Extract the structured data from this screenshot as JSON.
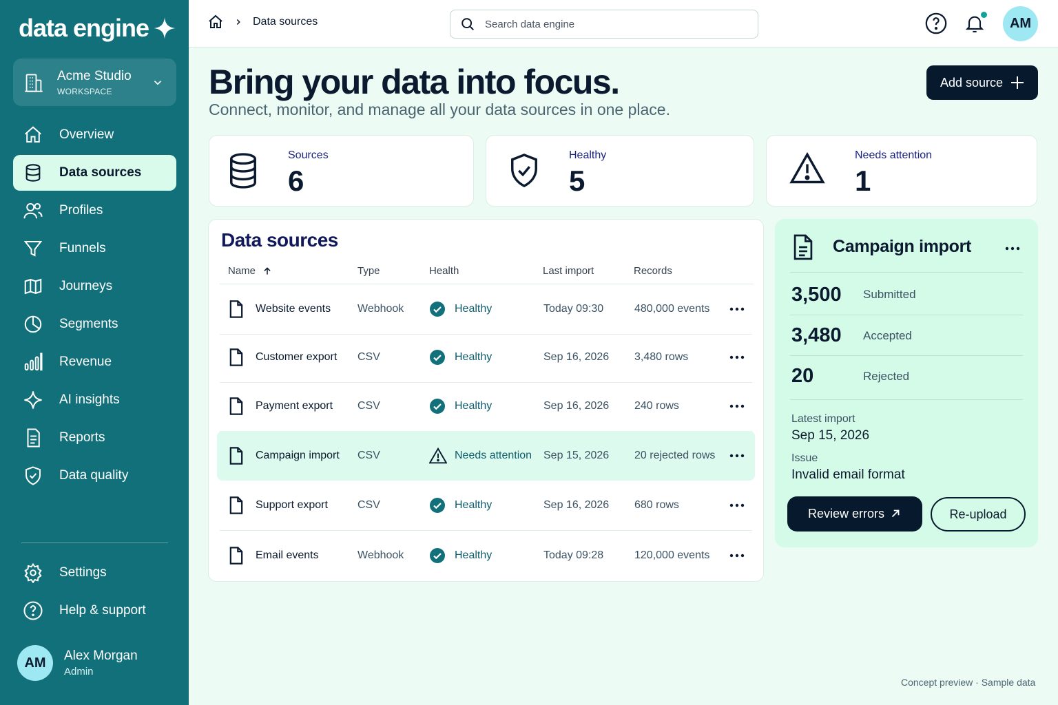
{
  "brand": {
    "name": "data engine"
  },
  "workspace": {
    "name": "Acme Studio",
    "label": "WORKSPACE"
  },
  "nav": {
    "items": [
      {
        "label": "Overview",
        "icon": "home-icon"
      },
      {
        "label": "Data sources",
        "icon": "database-icon",
        "active": true
      },
      {
        "label": "Profiles",
        "icon": "users-icon"
      },
      {
        "label": "Funnels",
        "icon": "funnel-icon"
      },
      {
        "label": "Journeys",
        "icon": "map-icon"
      },
      {
        "label": "Segments",
        "icon": "pie-icon"
      },
      {
        "label": "Revenue",
        "icon": "bar-chart-icon"
      },
      {
        "label": "AI insights",
        "icon": "sparkle-icon"
      },
      {
        "label": "Reports",
        "icon": "report-icon"
      },
      {
        "label": "Data quality",
        "icon": "shield-check-icon"
      }
    ],
    "bottom": [
      {
        "label": "Settings",
        "icon": "gear-icon"
      },
      {
        "label": "Help & support",
        "icon": "help-icon"
      }
    ]
  },
  "user": {
    "initials": "AM",
    "name": "Alex Morgan",
    "role": "Admin"
  },
  "header": {
    "breadcrumb": "Data sources",
    "search_placeholder": "Search data engine",
    "avatar_initials": "AM"
  },
  "hero": {
    "title": "Bring your data into focus.",
    "subtitle": "Connect, monitor, and manage all your data sources in one place.",
    "add_button": "Add source"
  },
  "stats": [
    {
      "label": "Sources",
      "value": "6"
    },
    {
      "label": "Healthy",
      "value": "5"
    },
    {
      "label": "Needs attention",
      "value": "1"
    }
  ],
  "table": {
    "title": "Data sources",
    "columns": [
      "Name",
      "Type",
      "Health",
      "Last import",
      "Records"
    ],
    "rows": [
      {
        "name": "Website events",
        "type": "Webhook",
        "health": "Healthy",
        "status": "ok",
        "last_import": "Today 09:30",
        "records": "480,000 events"
      },
      {
        "name": "Customer export",
        "type": "CSV",
        "health": "Healthy",
        "status": "ok",
        "last_import": "Sep 16, 2026",
        "records": "3,480 rows"
      },
      {
        "name": "Payment export",
        "type": "CSV",
        "health": "Healthy",
        "status": "ok",
        "last_import": "Sep 16, 2026",
        "records": "240 rows"
      },
      {
        "name": "Campaign import",
        "type": "CSV",
        "health": "Needs attention",
        "status": "warn",
        "last_import": "Sep 15, 2026",
        "records": "20 rejected rows"
      },
      {
        "name": "Support export",
        "type": "CSV",
        "health": "Healthy",
        "status": "ok",
        "last_import": "Sep 16, 2026",
        "records": "680 rows"
      },
      {
        "name": "Email events",
        "type": "Webhook",
        "health": "Healthy",
        "status": "ok",
        "last_import": "Today 09:28",
        "records": "120,000 events"
      }
    ]
  },
  "detail": {
    "title": "Campaign import",
    "metrics": [
      {
        "value": "3,500",
        "label": "Submitted"
      },
      {
        "value": "3,480",
        "label": "Accepted"
      },
      {
        "value": "20",
        "label": "Rejected"
      }
    ],
    "latest_import_label": "Latest import",
    "latest_import_value": "Sep 15, 2026",
    "issue_label": "Issue",
    "issue_value": "Invalid email format",
    "primary_button": "Review errors",
    "secondary_button": "Re-upload"
  },
  "footnote": "Concept preview · Sample data",
  "colors": {
    "sidebar": "#11707a",
    "background": "#ecfbf4",
    "accent": "#11a39a",
    "dark": "#071a2d",
    "panel": "#d4fbe8"
  }
}
